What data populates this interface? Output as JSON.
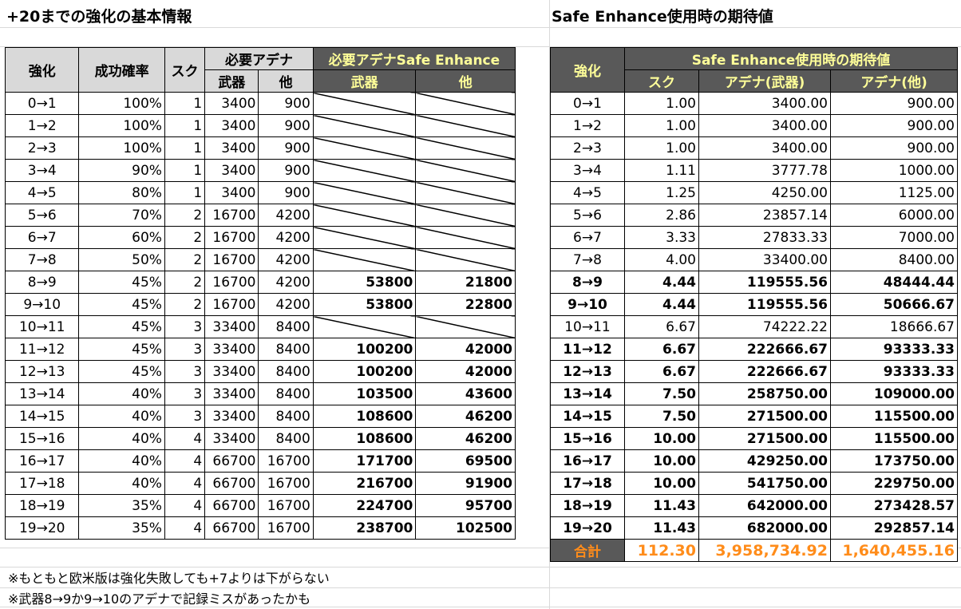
{
  "left": {
    "title": "+20までの強化の基本情報",
    "headers": {
      "enhance": "強化",
      "rate": "成功確率",
      "scroll": "スク",
      "adena_group": "必要アデナ",
      "weapon": "武器",
      "other": "他",
      "safe_group": "必要アデナSafe Enhance",
      "safe_weapon": "武器",
      "safe_other": "他"
    },
    "rows": [
      {
        "step": "0→1",
        "rate": "100%",
        "scroll": "1",
        "weapon": "3400",
        "other": "900",
        "safe_weapon": "",
        "safe_other": ""
      },
      {
        "step": "1→2",
        "rate": "100%",
        "scroll": "1",
        "weapon": "3400",
        "other": "900",
        "safe_weapon": "",
        "safe_other": ""
      },
      {
        "step": "2→3",
        "rate": "100%",
        "scroll": "1",
        "weapon": "3400",
        "other": "900",
        "safe_weapon": "",
        "safe_other": ""
      },
      {
        "step": "3→4",
        "rate": "90%",
        "scroll": "1",
        "weapon": "3400",
        "other": "900",
        "safe_weapon": "",
        "safe_other": ""
      },
      {
        "step": "4→5",
        "rate": "80%",
        "scroll": "1",
        "weapon": "3400",
        "other": "900",
        "safe_weapon": "",
        "safe_other": ""
      },
      {
        "step": "5→6",
        "rate": "70%",
        "scroll": "2",
        "weapon": "16700",
        "other": "4200",
        "safe_weapon": "",
        "safe_other": ""
      },
      {
        "step": "6→7",
        "rate": "60%",
        "scroll": "2",
        "weapon": "16700",
        "other": "4200",
        "safe_weapon": "",
        "safe_other": ""
      },
      {
        "step": "7→8",
        "rate": "50%",
        "scroll": "2",
        "weapon": "16700",
        "other": "4200",
        "safe_weapon": "",
        "safe_other": ""
      },
      {
        "step": "8→9",
        "rate": "45%",
        "scroll": "2",
        "weapon": "16700",
        "other": "4200",
        "safe_weapon": "53800",
        "safe_other": "21800"
      },
      {
        "step": "9→10",
        "rate": "45%",
        "scroll": "2",
        "weapon": "16700",
        "other": "4200",
        "safe_weapon": "53800",
        "safe_other": "22800"
      },
      {
        "step": "10→11",
        "rate": "45%",
        "scroll": "3",
        "weapon": "33400",
        "other": "8400",
        "safe_weapon": "",
        "safe_other": ""
      },
      {
        "step": "11→12",
        "rate": "45%",
        "scroll": "3",
        "weapon": "33400",
        "other": "8400",
        "safe_weapon": "100200",
        "safe_other": "42000"
      },
      {
        "step": "12→13",
        "rate": "45%",
        "scroll": "3",
        "weapon": "33400",
        "other": "8400",
        "safe_weapon": "100200",
        "safe_other": "42000"
      },
      {
        "step": "13→14",
        "rate": "40%",
        "scroll": "3",
        "weapon": "33400",
        "other": "8400",
        "safe_weapon": "103500",
        "safe_other": "43600"
      },
      {
        "step": "14→15",
        "rate": "40%",
        "scroll": "3",
        "weapon": "33400",
        "other": "8400",
        "safe_weapon": "108600",
        "safe_other": "46200"
      },
      {
        "step": "15→16",
        "rate": "40%",
        "scroll": "4",
        "weapon": "33400",
        "other": "8400",
        "safe_weapon": "108600",
        "safe_other": "46200"
      },
      {
        "step": "16→17",
        "rate": "40%",
        "scroll": "4",
        "weapon": "66700",
        "other": "16700",
        "safe_weapon": "171700",
        "safe_other": "69500"
      },
      {
        "step": "17→18",
        "rate": "40%",
        "scroll": "4",
        "weapon": "66700",
        "other": "16700",
        "safe_weapon": "216700",
        "safe_other": "91900"
      },
      {
        "step": "18→19",
        "rate": "35%",
        "scroll": "4",
        "weapon": "66700",
        "other": "16700",
        "safe_weapon": "224700",
        "safe_other": "95700"
      },
      {
        "step": "19→20",
        "rate": "35%",
        "scroll": "4",
        "weapon": "66700",
        "other": "16700",
        "safe_weapon": "238700",
        "safe_other": "102500"
      }
    ]
  },
  "right": {
    "title": "Safe Enhance使用時の期待値",
    "headers": {
      "enhance": "強化",
      "group": "Safe Enhance使用時の期待値",
      "scroll": "スク",
      "adena_weapon": "アデナ(武器)",
      "adena_other": "アデナ(他)"
    },
    "rows": [
      {
        "step": "0→1",
        "scroll": "1.00",
        "weapon": "3400.00",
        "other": "900.00",
        "bold": false
      },
      {
        "step": "1→2",
        "scroll": "1.00",
        "weapon": "3400.00",
        "other": "900.00",
        "bold": false
      },
      {
        "step": "2→3",
        "scroll": "1.00",
        "weapon": "3400.00",
        "other": "900.00",
        "bold": false
      },
      {
        "step": "3→4",
        "scroll": "1.11",
        "weapon": "3777.78",
        "other": "1000.00",
        "bold": false
      },
      {
        "step": "4→5",
        "scroll": "1.25",
        "weapon": "4250.00",
        "other": "1125.00",
        "bold": false
      },
      {
        "step": "5→6",
        "scroll": "2.86",
        "weapon": "23857.14",
        "other": "6000.00",
        "bold": false
      },
      {
        "step": "6→7",
        "scroll": "3.33",
        "weapon": "27833.33",
        "other": "7000.00",
        "bold": false
      },
      {
        "step": "7→8",
        "scroll": "4.00",
        "weapon": "33400.00",
        "other": "8400.00",
        "bold": false
      },
      {
        "step": "8→9",
        "scroll": "4.44",
        "weapon": "119555.56",
        "other": "48444.44",
        "bold": true
      },
      {
        "step": "9→10",
        "scroll": "4.44",
        "weapon": "119555.56",
        "other": "50666.67",
        "bold": true
      },
      {
        "step": "10→11",
        "scroll": "6.67",
        "weapon": "74222.22",
        "other": "18666.67",
        "bold": false
      },
      {
        "step": "11→12",
        "scroll": "6.67",
        "weapon": "222666.67",
        "other": "93333.33",
        "bold": true
      },
      {
        "step": "12→13",
        "scroll": "6.67",
        "weapon": "222666.67",
        "other": "93333.33",
        "bold": true
      },
      {
        "step": "13→14",
        "scroll": "7.50",
        "weapon": "258750.00",
        "other": "109000.00",
        "bold": true
      },
      {
        "step": "14→15",
        "scroll": "7.50",
        "weapon": "271500.00",
        "other": "115500.00",
        "bold": true
      },
      {
        "step": "15→16",
        "scroll": "10.00",
        "weapon": "271500.00",
        "other": "115500.00",
        "bold": true
      },
      {
        "step": "16→17",
        "scroll": "10.00",
        "weapon": "429250.00",
        "other": "173750.00",
        "bold": true
      },
      {
        "step": "17→18",
        "scroll": "10.00",
        "weapon": "541750.00",
        "other": "229750.00",
        "bold": true
      },
      {
        "step": "18→19",
        "scroll": "11.43",
        "weapon": "642000.00",
        "other": "273428.57",
        "bold": true
      },
      {
        "step": "19→20",
        "scroll": "11.43",
        "weapon": "682000.00",
        "other": "292857.14",
        "bold": true
      }
    ],
    "total": {
      "label": "合計",
      "scroll": "112.30",
      "weapon": "3,958,734.92",
      "other": "1,640,455.16"
    }
  },
  "notes": [
    "※もともと欧米版は強化失敗しても+7よりは下がらない",
    "※武器8→9か9→10のアデナで記録ミスがあったかも"
  ],
  "colors": {
    "header_dark": "#595959",
    "header_text_yellow": "#ffff99",
    "total_orange": "#ff8c1a",
    "header_light": "#d9d9d9"
  }
}
